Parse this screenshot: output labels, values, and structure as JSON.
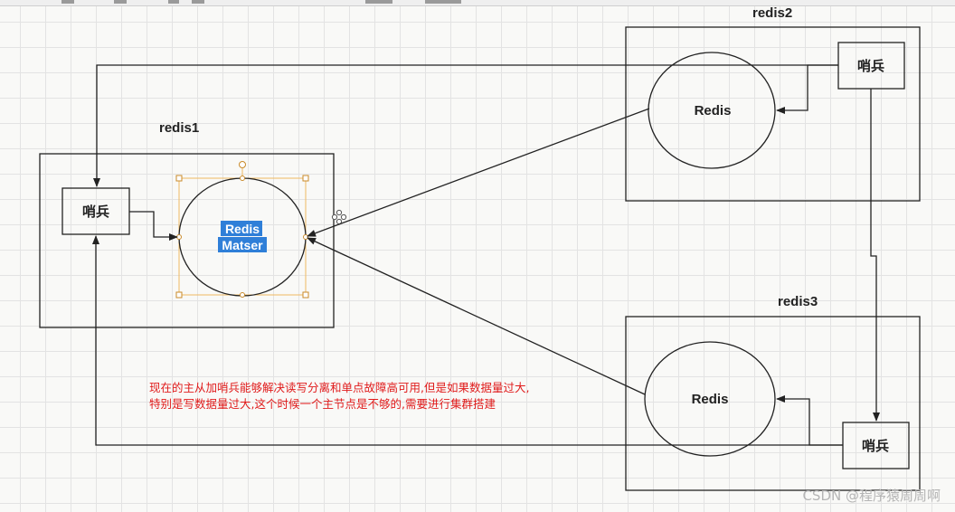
{
  "groups": {
    "redis1": "redis1",
    "redis2": "redis2",
    "redis3": "redis3"
  },
  "nodes": {
    "sentinel_label": "哨兵",
    "redis_label": "Redis",
    "master_line1": "Redis",
    "master_line2": "Matser"
  },
  "note": {
    "line1": "现在的主从加哨兵能够解决读写分离和单点故障高可用,但是如果数据量过大,",
    "line2": "特别是写数据量过大,这个时候一个主节点是不够的,需要进行集群搭建"
  },
  "watermark": "CSDN @程序猿周周啊",
  "colors": {
    "stroke": "#222222",
    "selection": "#f0b960",
    "highlight": "#2f7fd8",
    "note": "#e01b1b"
  }
}
